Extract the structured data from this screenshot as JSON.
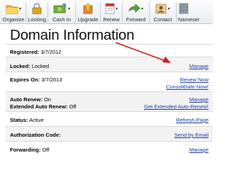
{
  "toolbar": {
    "items": [
      {
        "label": "Organize",
        "icon": "folder-icon",
        "dropdown": true
      },
      {
        "label": "Locking",
        "icon": "lock-icon",
        "dropdown": false
      },
      {
        "label": "Cash In",
        "icon": "cash-in-icon",
        "dropdown": true
      },
      {
        "label": "Upgrade",
        "icon": "upgrade-icon",
        "dropdown": false
      },
      {
        "label": "Renew",
        "icon": "renew-icon",
        "dropdown": true
      },
      {
        "label": "Forward",
        "icon": "forward-icon",
        "dropdown": true
      },
      {
        "label": "Contact",
        "icon": "contact-icon",
        "dropdown": true
      },
      {
        "label": "Nameser",
        "icon": "nameserver-icon",
        "dropdown": false
      }
    ]
  },
  "page_title": "Domain Information",
  "rows": [
    {
      "label": "Registered:",
      "value": "3/7/2012",
      "links": []
    },
    {
      "label": "Locked:",
      "value": "Locked",
      "links": [
        "Manage"
      ]
    },
    {
      "label": "Expires On:",
      "value": "3/7/2013",
      "links": [
        "Renew Now",
        "ConsoliDate Now!"
      ]
    },
    {
      "label": "Auto Renew:",
      "value": "On",
      "label2": "Extended Auto Renew:",
      "value2": "Off",
      "links": [
        "Manage",
        "Get Extended Auto-Renew!"
      ]
    },
    {
      "label": "Status:",
      "value": "Active",
      "links": [
        "Refresh Page"
      ]
    },
    {
      "label": "Authorization Code:",
      "value": "",
      "links": [
        "Send by Email"
      ]
    },
    {
      "label": "Forwarding:",
      "value": "Off",
      "links": [
        "Manage"
      ]
    }
  ],
  "colors": {
    "link": "#1a3f9e",
    "arrow": "#cc1f1f",
    "alt_row": "#f3f3f3"
  }
}
